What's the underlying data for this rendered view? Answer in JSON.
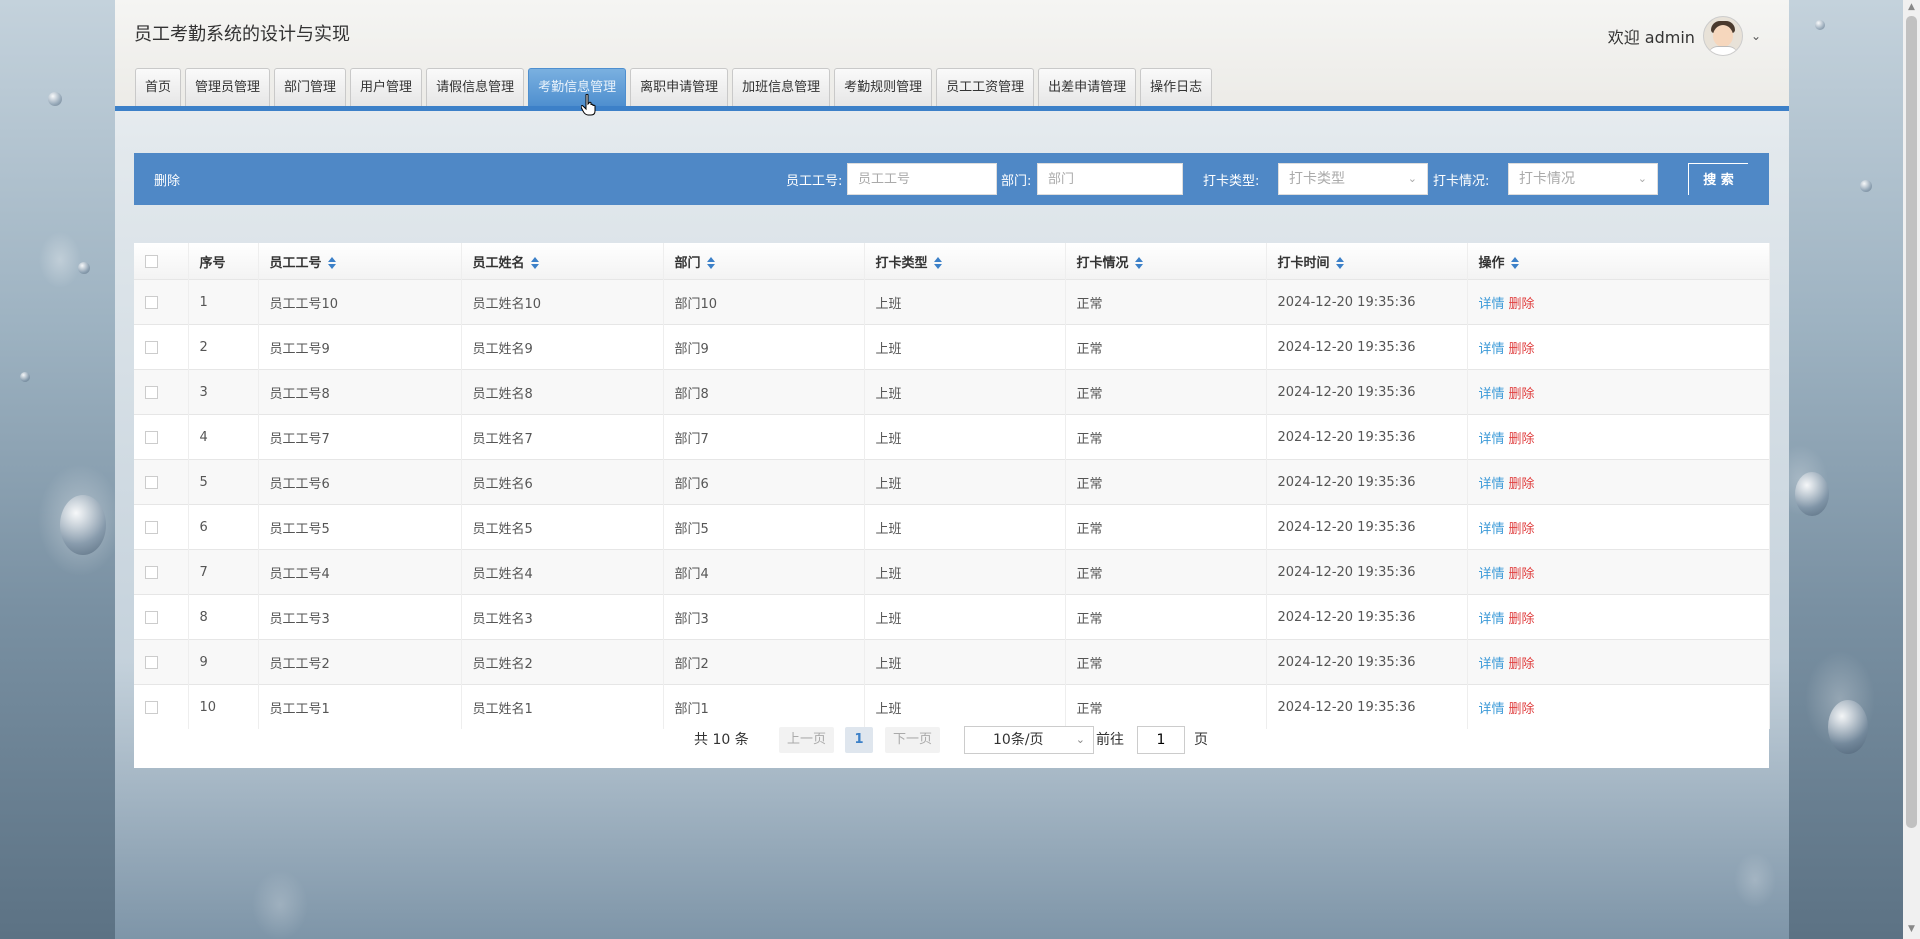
{
  "app": {
    "title": "员工考勤系统的设计与实现",
    "welcome": "欢迎 admin"
  },
  "nav": {
    "tabs": [
      "首页",
      "管理员管理",
      "部门管理",
      "用户管理",
      "请假信息管理",
      "考勤信息管理",
      "离职申请管理",
      "加班信息管理",
      "考勤规则管理",
      "员工工资管理",
      "出差申请管理",
      "操作日志"
    ],
    "active_index": 5
  },
  "search": {
    "delete_label": "删除",
    "emp_no_label": "员工工号:",
    "emp_no_placeholder": "员工工号",
    "dept_label": "部门:",
    "dept_placeholder": "部门",
    "punch_type_label": "打卡类型:",
    "punch_type_placeholder": "打卡类型",
    "punch_status_label": "打卡情况:",
    "punch_status_placeholder": "打卡情况",
    "search_label": "搜 索"
  },
  "table": {
    "headers": [
      "序号",
      "员工工号",
      "员工姓名",
      "部门",
      "打卡类型",
      "打卡情况",
      "打卡时间",
      "操作"
    ],
    "detail_label": "详情",
    "delete_label": "删除",
    "rows": [
      {
        "no": "1",
        "emp_no": "员工工号10",
        "name": "员工姓名10",
        "dept": "部门10",
        "type": "上班",
        "status": "正常",
        "time": "2024-12-20 19:35:36"
      },
      {
        "no": "2",
        "emp_no": "员工工号9",
        "name": "员工姓名9",
        "dept": "部门9",
        "type": "上班",
        "status": "正常",
        "time": "2024-12-20 19:35:36"
      },
      {
        "no": "3",
        "emp_no": "员工工号8",
        "name": "员工姓名8",
        "dept": "部门8",
        "type": "上班",
        "status": "正常",
        "time": "2024-12-20 19:35:36"
      },
      {
        "no": "4",
        "emp_no": "员工工号7",
        "name": "员工姓名7",
        "dept": "部门7",
        "type": "上班",
        "status": "正常",
        "time": "2024-12-20 19:35:36"
      },
      {
        "no": "5",
        "emp_no": "员工工号6",
        "name": "员工姓名6",
        "dept": "部门6",
        "type": "上班",
        "status": "正常",
        "time": "2024-12-20 19:35:36"
      },
      {
        "no": "6",
        "emp_no": "员工工号5",
        "name": "员工姓名5",
        "dept": "部门5",
        "type": "上班",
        "status": "正常",
        "time": "2024-12-20 19:35:36"
      },
      {
        "no": "7",
        "emp_no": "员工工号4",
        "name": "员工姓名4",
        "dept": "部门4",
        "type": "上班",
        "status": "正常",
        "time": "2024-12-20 19:35:36"
      },
      {
        "no": "8",
        "emp_no": "员工工号3",
        "name": "员工姓名3",
        "dept": "部门3",
        "type": "上班",
        "status": "正常",
        "time": "2024-12-20 19:35:36"
      },
      {
        "no": "9",
        "emp_no": "员工工号2",
        "name": "员工姓名2",
        "dept": "部门2",
        "type": "上班",
        "status": "正常",
        "time": "2024-12-20 19:35:36"
      },
      {
        "no": "10",
        "emp_no": "员工工号1",
        "name": "员工姓名1",
        "dept": "部门1",
        "type": "上班",
        "status": "正常",
        "time": "2024-12-20 19:35:36"
      }
    ]
  },
  "pagination": {
    "total": "共 10 条",
    "prev": "上一页",
    "current": "1",
    "next": "下一页",
    "page_size": "10条/页",
    "goto_prefix": "前往",
    "goto_value": "1",
    "goto_suffix": "页"
  },
  "colors": {
    "accent": "#4f88c6",
    "nav_line": "#3c80c8",
    "detail": "#3c9ad8",
    "delete": "#e04040"
  },
  "icons": {
    "avatar": "avatar-cartoon",
    "chevron": "chevron-down-icon",
    "sort": "sort-icon"
  }
}
